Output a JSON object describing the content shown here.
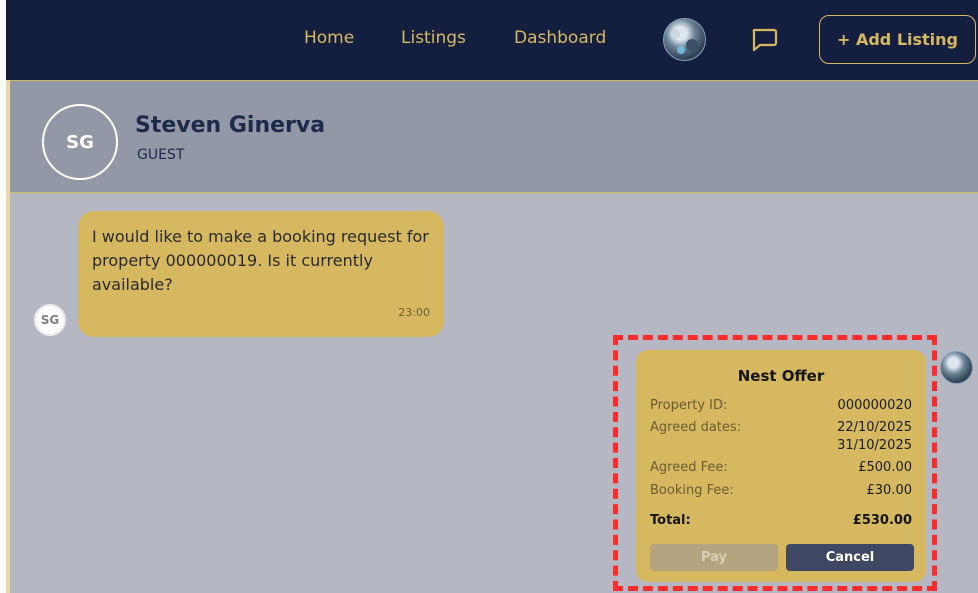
{
  "nav": {
    "links": [
      "Home",
      "Listings",
      "Dashboard"
    ],
    "add_listing_label": "+ Add Listing",
    "chat_icon": "chat-bubble-icon"
  },
  "conversation": {
    "contact_initials": "SG",
    "contact_name": "Steven Ginerva",
    "contact_role": "GUEST"
  },
  "messages": [
    {
      "sender_initials": "SG",
      "text": "I would like to make a booking request for property 000000019. Is it currently available?",
      "time": "23:00"
    }
  ],
  "offer": {
    "title": "Nest Offer",
    "property_id_label": "Property ID:",
    "property_id": "000000020",
    "agreed_dates_label": "Agreed dates:",
    "agreed_date_start": "22/10/2025",
    "agreed_date_end": "31/10/2025",
    "agreed_fee_label": "Agreed Fee:",
    "agreed_fee": "£500.00",
    "booking_fee_label": "Booking Fee:",
    "booking_fee": "£30.00",
    "total_label": "Total:",
    "total": "£530.00",
    "pay_label": "Pay",
    "cancel_label": "Cancel"
  },
  "colors": {
    "navbar": "#141f3f",
    "gold": "#d6b861",
    "chat_background": "#b5b8c3",
    "header_background": "#9298a6",
    "cancel_button": "#3f4862",
    "highlight": "#ff2a2a"
  }
}
